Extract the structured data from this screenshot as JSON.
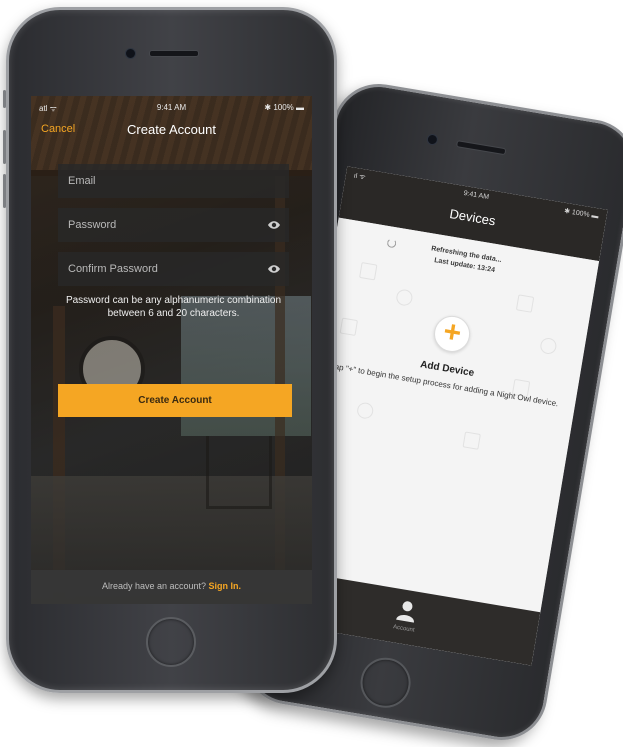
{
  "front": {
    "status": {
      "signal": "atl ᯤ",
      "time": "9:41 AM",
      "battery": "✱ 100% ▬"
    },
    "header": {
      "cancel_label": "Cancel",
      "title": "Create Account"
    },
    "form": {
      "email_placeholder": "Email",
      "password_placeholder": "Password",
      "confirm_placeholder": "Confirm Password",
      "hint": "Password can be any alphanumeric combination between 6 and 20 characters."
    },
    "create_button_label": "Create Account",
    "footer": {
      "prompt": "Already have an account?",
      "sign_in": "Sign In."
    }
  },
  "back": {
    "status": {
      "signal": "ıl ᯤ",
      "time": "9:41 AM",
      "battery": "✱ 100% ▬"
    },
    "header": {
      "title": "Devices"
    },
    "refresh": {
      "line1": "Refreshing the data...",
      "line2": "Last update: 13:24"
    },
    "add_device": {
      "icon": "+",
      "title": "Add Device",
      "description": "Tap \"+\" to begin the setup process for adding a Night Owl device."
    },
    "tabbar": {
      "account_label": "Account"
    }
  },
  "colors": {
    "accent": "#f5a623",
    "dark_bar": "#2a2826"
  },
  "icons": [
    "eye-icon",
    "plus-icon",
    "account-person-icon",
    "spinner-icon"
  ]
}
